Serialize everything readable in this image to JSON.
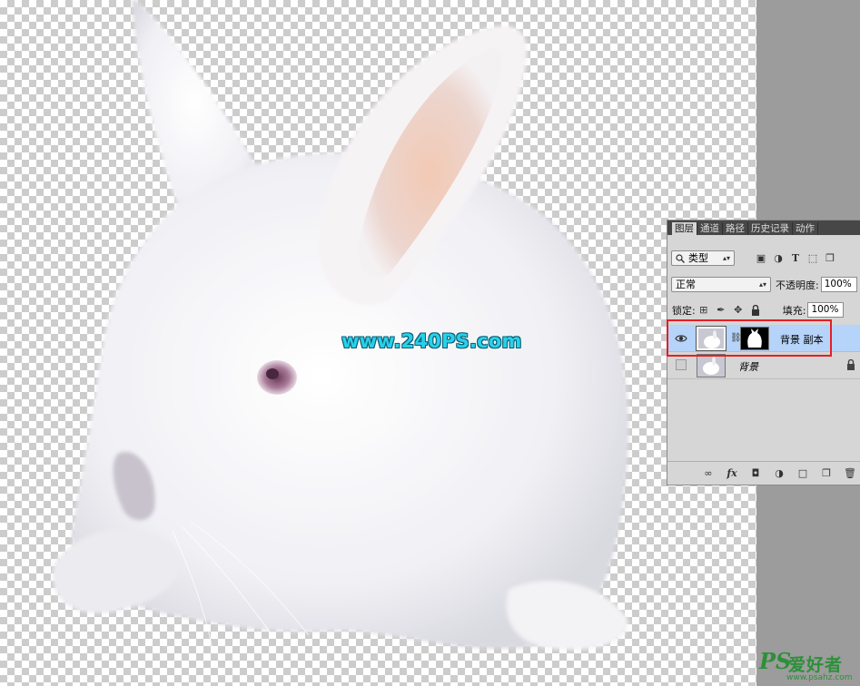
{
  "watermark": {
    "text": "www.240PS.com"
  },
  "site_logo": {
    "mark": "PS",
    "title": "爱好者",
    "url": "www.psahz.com"
  },
  "layers_panel": {
    "tabs": [
      {
        "label": "图层",
        "active": true
      },
      {
        "label": "通道",
        "active": false
      },
      {
        "label": "路径",
        "active": false
      },
      {
        "label": "历史记录",
        "active": false
      },
      {
        "label": "动作",
        "active": false
      }
    ],
    "filter": {
      "label": "类型",
      "icon": "search-icon"
    },
    "blend_mode": "正常",
    "opacity": {
      "label": "不透明度:",
      "value": "100%"
    },
    "lock": {
      "label": "锁定:"
    },
    "fill": {
      "label": "填充:",
      "value": "100%"
    },
    "layers": [
      {
        "name": "背景 副本",
        "visible": true,
        "selected": true,
        "has_mask": true
      },
      {
        "name": "背景",
        "visible": false,
        "selected": false,
        "locked": true
      }
    ]
  },
  "colors": {
    "selection": "#b6d3f9",
    "highlight_border": "#e41e25",
    "watermark": "#2ad0ea",
    "logo": "#2e8f3a"
  }
}
